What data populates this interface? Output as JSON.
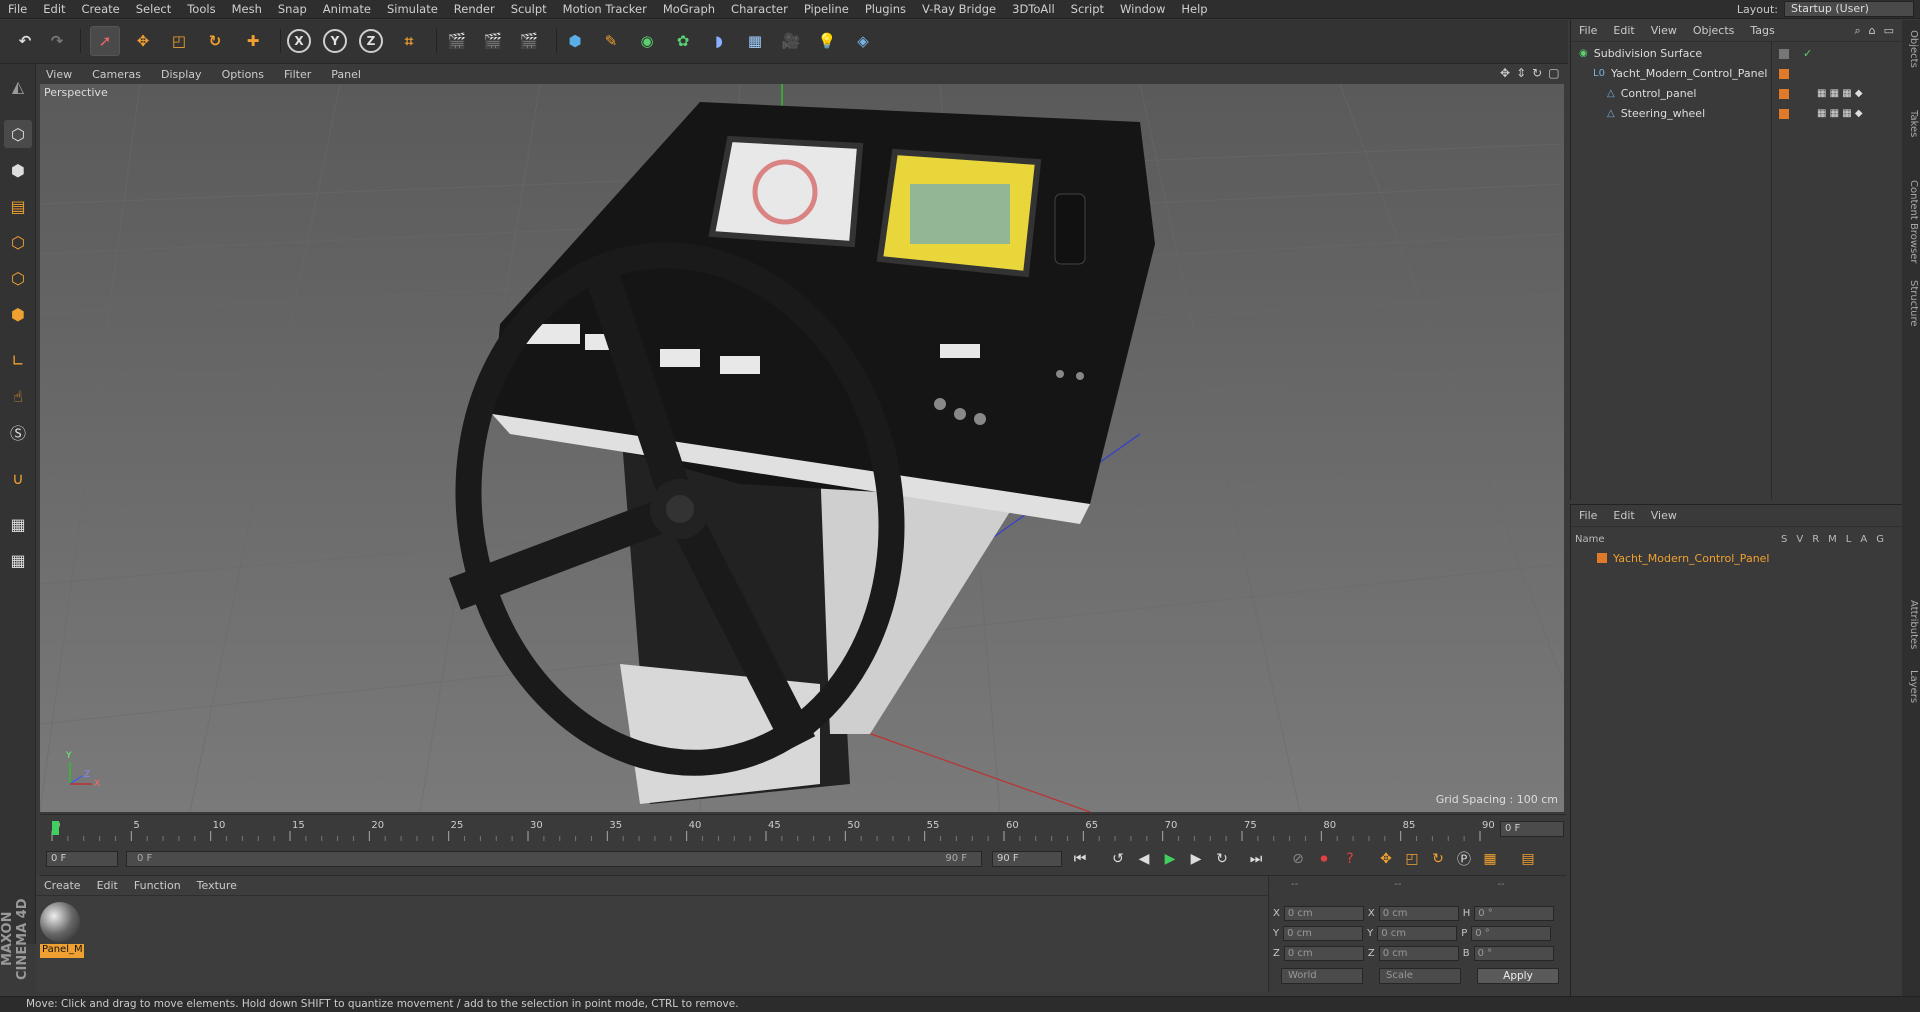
{
  "menu": [
    "File",
    "Edit",
    "Create",
    "Select",
    "Tools",
    "Mesh",
    "Snap",
    "Animate",
    "Simulate",
    "Render",
    "Sculpt",
    "Motion Tracker",
    "MoGraph",
    "Character",
    "Pipeline",
    "Plugins",
    "V-Ray Bridge",
    "3DToAll",
    "Script",
    "Window",
    "Help"
  ],
  "layout": {
    "label": "Layout:",
    "value": "Startup (User)"
  },
  "viewport_menu": [
    "View",
    "Cameras",
    "Display",
    "Options",
    "Filter",
    "Panel"
  ],
  "viewport": {
    "label": "Perspective",
    "grid_spacing": "Grid Spacing : 100 cm",
    "axis_y": "Y",
    "axis_z": "Z",
    "axis_x": "X"
  },
  "timeline": {
    "ticks": [
      "0",
      "5",
      "10",
      "15",
      "20",
      "25",
      "30",
      "35",
      "40",
      "45",
      "50",
      "55",
      "60",
      "65",
      "70",
      "75",
      "80",
      "85",
      "90"
    ],
    "current_frame": "0 F",
    "start_frame": "0 F",
    "range_start": "0 F",
    "range_end": "90 F",
    "end_frame": "90 F"
  },
  "material_menu": [
    "Create",
    "Edit",
    "Function",
    "Texture"
  ],
  "material": {
    "name": "Panel_M"
  },
  "coords": {
    "header": [
      "--",
      "--",
      "--"
    ],
    "rows": [
      {
        "a": "X",
        "av": "0 cm",
        "b": "X",
        "bv": "0 cm",
        "c": "H",
        "cv": "0 °"
      },
      {
        "a": "Y",
        "av": "0 cm",
        "b": "Y",
        "bv": "0 cm",
        "c": "P",
        "cv": "0 °"
      },
      {
        "a": "Z",
        "av": "0 cm",
        "b": "Z",
        "bv": "0 cm",
        "c": "B",
        "cv": "0 °"
      }
    ],
    "space": "World",
    "mode": "Scale",
    "apply": "Apply"
  },
  "object_menu": [
    "File",
    "Edit",
    "View",
    "Objects",
    "Tags"
  ],
  "objects": [
    {
      "name": "Subdivision Surface",
      "indent": 0
    },
    {
      "name": "Yacht_Modern_Control_Panel",
      "indent": 1
    },
    {
      "name": "Control_panel",
      "indent": 2
    },
    {
      "name": "Steering_wheel",
      "indent": 2
    }
  ],
  "layer_menu": [
    "File",
    "Edit",
    "View"
  ],
  "layer_columns": {
    "name": "Name",
    "flags": [
      "S",
      "V",
      "R",
      "M",
      "L",
      "A",
      "G"
    ]
  },
  "layers": [
    {
      "name": "Yacht_Modern_Control_Panel",
      "color": "#e07a2a"
    }
  ],
  "side_tabs": [
    "Objects",
    "Takes",
    "Content Browser",
    "Structure",
    "Attributes",
    "Layers"
  ],
  "brand": "MAXON CINEMA 4D",
  "status": "Move: Click and drag to move elements. Hold down SHIFT to quantize movement / add to the selection in point mode, CTRL to remove.",
  "colors": {
    "accent": "#e07a2a",
    "selected_text": "#f0a030"
  }
}
